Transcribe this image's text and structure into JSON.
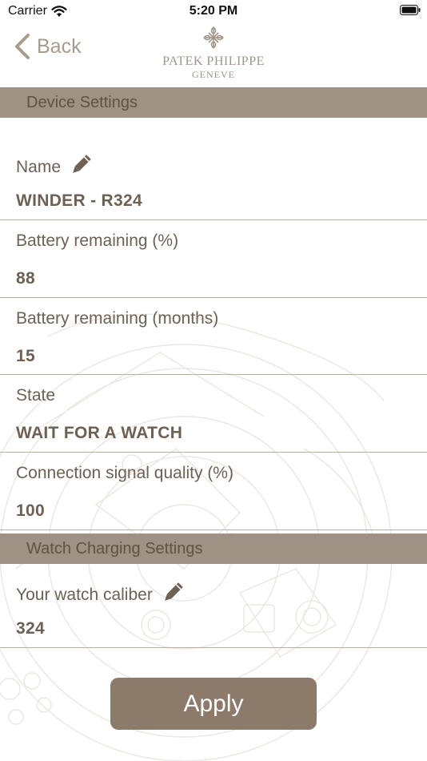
{
  "status_bar": {
    "carrier": "Carrier",
    "time": "5:20 PM"
  },
  "nav": {
    "back_label": "Back",
    "logo_brand": "PATEK PHILIPPE",
    "logo_city": "GENEVE"
  },
  "sections": {
    "device_settings": "Device Settings",
    "watch_charging_settings": "Watch Charging Settings"
  },
  "device": {
    "name_label": "Name",
    "name_value": "WINDER - R324",
    "battery_pct_label": "Battery remaining (%)",
    "battery_pct_value": "88",
    "battery_months_label": "Battery remaining (months)",
    "battery_months_value": "15",
    "state_label": "State",
    "state_value": "WAIT FOR A WATCH",
    "signal_label": "Connection signal quality (%)",
    "signal_value": "100"
  },
  "charging": {
    "caliber_label": "Your watch caliber",
    "caliber_value": "324"
  },
  "actions": {
    "apply_label": "Apply"
  },
  "colors": {
    "section_header_bg": "#9f9183",
    "text": "#6e6053",
    "apply_button_bg": "#8c7b6a",
    "back_tint": "#a89c8d"
  },
  "icons": {
    "wifi": "wifi-icon",
    "battery": "battery-icon",
    "back": "chevron-left-icon",
    "logo": "calatrava-cross-icon",
    "edit": "pencil-icon"
  }
}
